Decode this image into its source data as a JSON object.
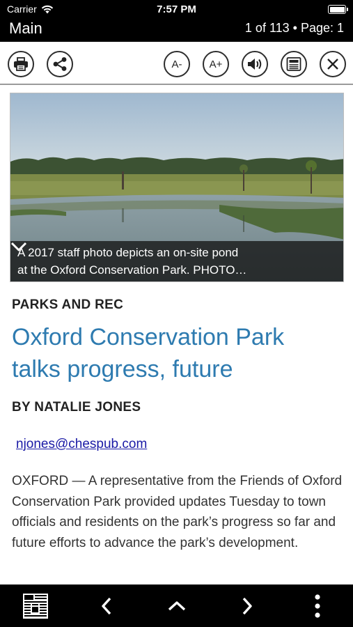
{
  "status_bar": {
    "carrier": "Carrier",
    "time": "7:57 PM"
  },
  "nav": {
    "title": "Main",
    "page_info": "1 of 113 • Page: 1"
  },
  "toolbar": {
    "print_icon": "printer-icon",
    "share_icon": "share-icon",
    "font_decrease": "A-",
    "font_increase": "A+",
    "audio_icon": "speaker-icon",
    "text_view_icon": "article-icon",
    "close_icon": "close-icon"
  },
  "photo": {
    "caption_line1": "A 2017 staff photo depicts an on-site pond",
    "caption_line2": "at the Oxford Conservation Park.  PHOTO…"
  },
  "article": {
    "section": "PARKS AND REC",
    "headline": "Oxford Conservation Park talks progress, future",
    "byline": "BY NATALIE JONES",
    "email": "njones@chespub.com",
    "body": "OXFORD — A representative from the Friends of Oxford Conservation Park provided updates Tuesday to town officials and residents on the park’s progress so far and future efforts to advance the park’s development."
  },
  "bottom_bar": {
    "newspaper_icon": "newspaper-icon",
    "prev_icon": "chevron-left-icon",
    "up_icon": "chevron-up-icon",
    "next_icon": "chevron-right-icon",
    "more_icon": "more-vertical-icon"
  },
  "colors": {
    "headline": "#2e7bb0",
    "link": "#1a1aa6",
    "bar": "#000000"
  }
}
